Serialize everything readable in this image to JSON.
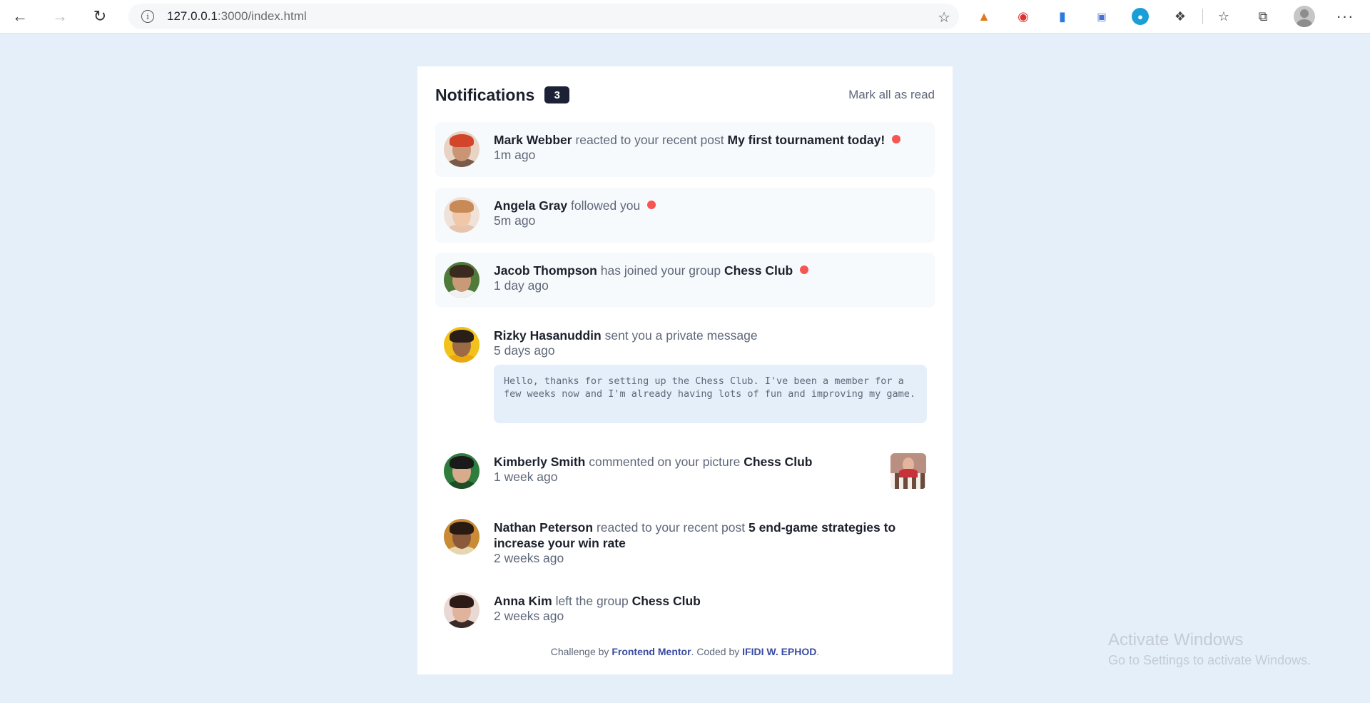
{
  "browser": {
    "url_host": "127.0.0.1",
    "url_path": ":3000/index.html",
    "info_icon": "i",
    "star_icon": "☆",
    "more_icon": "···"
  },
  "header": {
    "title": "Notifications",
    "count": "3",
    "mark_all": "Mark all as read"
  },
  "notifications": [
    {
      "name": "Mark Webber",
      "action": "reacted to your recent post",
      "target": "My first tournament today!",
      "time": "1m ago",
      "unread": true
    },
    {
      "name": "Angela Gray",
      "action": "followed you",
      "target": "",
      "time": "5m ago",
      "unread": true
    },
    {
      "name": "Jacob Thompson",
      "action": "has joined your group",
      "target": "Chess Club",
      "time": "1 day ago",
      "unread": true
    },
    {
      "name": "Rizky Hasanuddin",
      "action": "sent you a private message",
      "target": "",
      "time": "5 days ago",
      "unread": false,
      "message": "Hello, thanks for setting up the Chess Club. I've been a member for a few weeks now and I'm already having lots of fun and improving my game."
    },
    {
      "name": "Kimberly Smith",
      "action": "commented on your picture",
      "target": "Chess Club",
      "time": "1 week ago",
      "unread": false
    },
    {
      "name": "Nathan Peterson",
      "action": "reacted to your recent post",
      "target": "5 end-game strategies to increase your win rate",
      "time": "2 weeks ago",
      "unread": false
    },
    {
      "name": "Anna Kim",
      "action": "left the group",
      "target": "Chess Club",
      "time": "2 weeks ago",
      "unread": false
    }
  ],
  "footer": {
    "prefix": "Challenge by",
    "link1": "Frontend Mentor",
    "middle": ". Coded by",
    "link2": "IFIDI W. EPHOD",
    "suffix": "."
  },
  "watermark": {
    "line1": "Activate Windows",
    "line2": "Go to Settings to activate Windows."
  },
  "colors": {
    "background": "#e5effa",
    "unread_dot": "#f65552",
    "badge": "#1c2136",
    "link": "#3a4ba0"
  }
}
